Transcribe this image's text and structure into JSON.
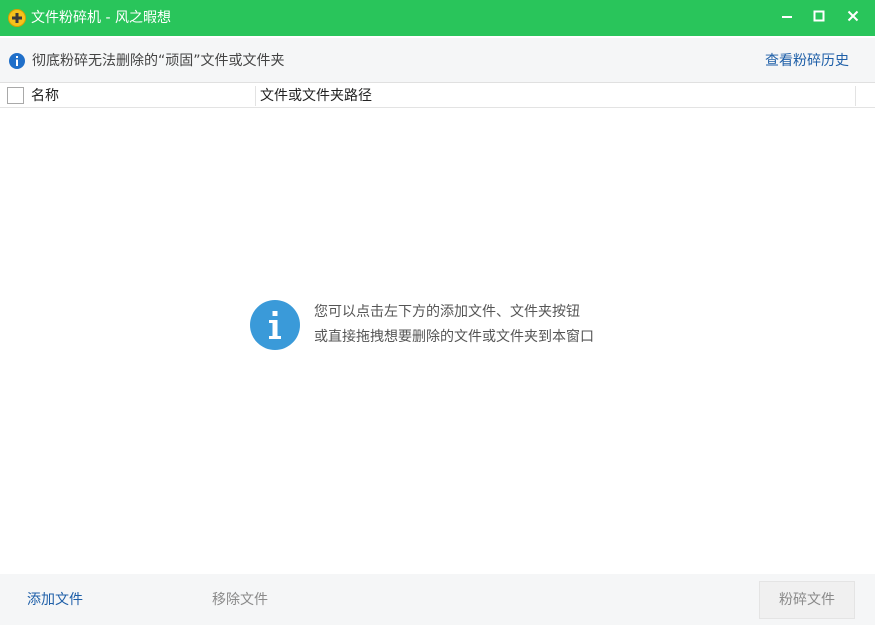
{
  "colors": {
    "titlebar": "#29c55b",
    "link": "#1e5fa8",
    "disabled_text": "#8a8a8a",
    "info_icon": "#3a9ad9"
  },
  "window": {
    "title": "文件粉碎机 - 风之暇想",
    "app_icon": "plus-circle-icon",
    "minimize_icon": "minimize-icon",
    "maximize_icon": "maximize-icon",
    "close_icon": "close-icon"
  },
  "infobar": {
    "icon": "info-icon",
    "text": "彻底粉碎无法删除的“顽固”文件或文件夹",
    "history_link": "查看粉碎历史"
  },
  "table": {
    "columns": [
      "名称",
      "文件或文件夹路径"
    ],
    "select_all_checked": false,
    "rows": []
  },
  "empty_hint": {
    "icon": "info-icon",
    "line1": "您可以点击左下方的添加文件、文件夹按钮",
    "line2": "或直接拖拽想要删除的文件或文件夹到本窗口"
  },
  "footer": {
    "add_file": "添加文件",
    "remove_file": "移除文件",
    "shred_button": "粉碎文件"
  }
}
